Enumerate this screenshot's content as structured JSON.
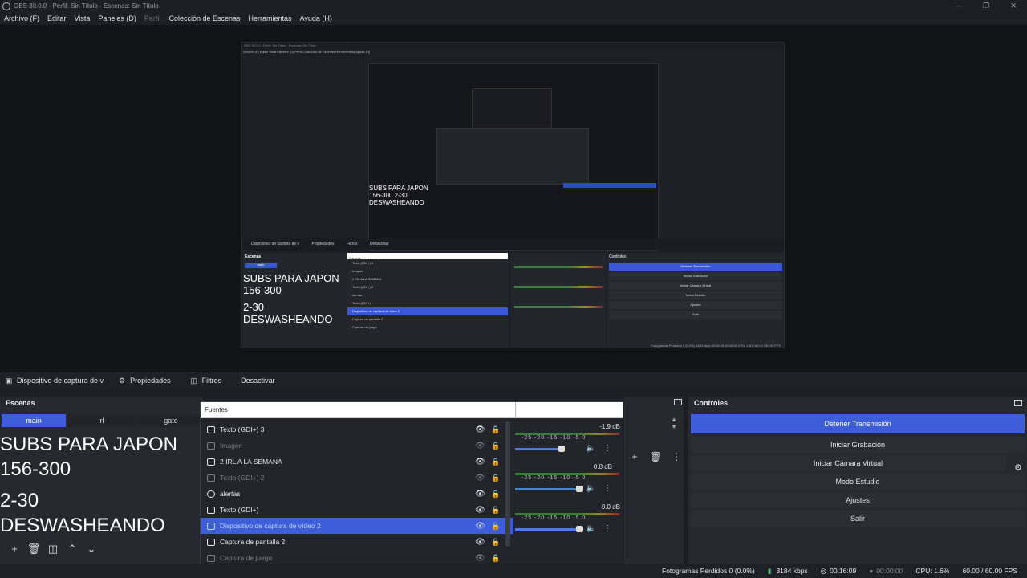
{
  "window": {
    "title": "OBS 30.0.0 - Perfil: Sin Título - Escenas: Sin Título",
    "controls": [
      "—",
      "❐",
      "✕"
    ]
  },
  "menu": [
    {
      "label": "Archivo (F)",
      "dim": false
    },
    {
      "label": "Editar",
      "dim": false
    },
    {
      "label": "Vista",
      "dim": false
    },
    {
      "label": "Paneles (D)",
      "dim": false
    },
    {
      "label": "Perfil",
      "dim": true
    },
    {
      "label": "Colección de Escenas",
      "dim": false
    },
    {
      "label": "Herramientas",
      "dim": false
    },
    {
      "label": "Ayuda (H)",
      "dim": false
    }
  ],
  "preview": {
    "title": "OBS 30.0.0 - Perfil: Sin Título - Escenas: Sin Título",
    "menu": "Archivo (F)  Editar  Vista  Paneles (D)  Perfil  Colección de Escenas  Herramientas  Ayuda (H)",
    "inner_text": "SUBS PARA JAPON 156-300 2-30 DESWASHEANDO",
    "bar": [
      "Dispositivo de captura de v",
      "Propiedades",
      "Filtros",
      "Desactivar"
    ],
    "scenes_head": "Escenas",
    "scene_tab": "main",
    "big_lines": [
      "SUBS PARA JAPON",
      "156-300",
      "2-30",
      "DESWASHEANDO"
    ],
    "src_header": "Fuentes",
    "src_rows": [
      "Texto (GDI+) 3",
      "Imagen",
      "2 IRL A LA SEMANA",
      "Texto (GDI+) 2",
      "alertas",
      "Texto (GDI+)",
      "Dispositivo de captura de vídeo 2",
      "Captura de pantalla 2",
      "Captura de juego"
    ],
    "controls_head": "Controles",
    "controls": [
      "Detener Transmisión",
      "Iniciar Grabación",
      "Iniciar Cámara Virtual",
      "Modo Estudio",
      "Ajustes",
      "Salir"
    ],
    "status": "Fotogramas Perdidos 0 (0.0%)   3184 kbps   00:16:09   00:00:00   CPU: 1.6%   60.00 / 60.00 FPS"
  },
  "source_bar": {
    "selected_source": "Dispositivo de captura de v",
    "properties": "Propiedades",
    "filters": "Filtros",
    "deactivate": "Desactivar"
  },
  "scenes": {
    "title": "Escenas",
    "tabs": [
      "main",
      "irl",
      "gato"
    ],
    "active_tab": "main",
    "lines": [
      "SUBS PARA JAPON",
      "156-300",
      "2-30",
      "DESWASHEANDO"
    ]
  },
  "sources": {
    "header": "Fuentes",
    "rows": [
      {
        "name": "Texto (GDI+) 3",
        "state": "normal",
        "icon": "text-icon"
      },
      {
        "name": "Imagen",
        "state": "dim",
        "icon": "image-icon"
      },
      {
        "name": "2 IRL A LA SEMANA",
        "state": "normal",
        "icon": "text-icon"
      },
      {
        "name": "Texto (GDI+) 2",
        "state": "dim",
        "icon": "text-icon"
      },
      {
        "name": "alertas",
        "state": "normal",
        "icon": "browser-icon"
      },
      {
        "name": "Texto (GDI+)",
        "state": "normal",
        "icon": "text-icon"
      },
      {
        "name": "Dispositivo de captura de vídeo 2",
        "state": "sel",
        "icon": "camera-icon"
      },
      {
        "name": "Captura de pantalla 2",
        "state": "normal",
        "icon": "monitor-icon"
      },
      {
        "name": "Captura de juego",
        "state": "dim",
        "icon": "gamepad-icon"
      }
    ]
  },
  "mixer": {
    "channels": [
      {
        "db": "-1.9 dB",
        "volume": 0.7
      },
      {
        "db": "0.0 dB",
        "volume": 1.0
      },
      {
        "db": "0.0 dB",
        "volume": 1.0
      }
    ],
    "ticks": "-25 -20 -15 -10 -5 0"
  },
  "controls": {
    "title": "Controles",
    "stop_stream": "Detener Transmisión",
    "start_recording": "Iniciar Grabación",
    "start_virtual_cam": "Iniciar Cámara Virtual",
    "studio_mode": "Modo Estudio",
    "settings": "Ajustes",
    "exit": "Salir"
  },
  "status": {
    "dropped_frames": "Fotogramas Perdidos 0 (0.0%)",
    "bitrate": "3184 kbps",
    "stream_time": "00:16:09",
    "rec_time": "00:00:00",
    "cpu": "CPU: 1.6%",
    "fps": "60.00 / 60.00 FPS"
  },
  "colors": {
    "accent": "#3e5dd9",
    "background": "#1d1f26",
    "dock": "#272930"
  }
}
